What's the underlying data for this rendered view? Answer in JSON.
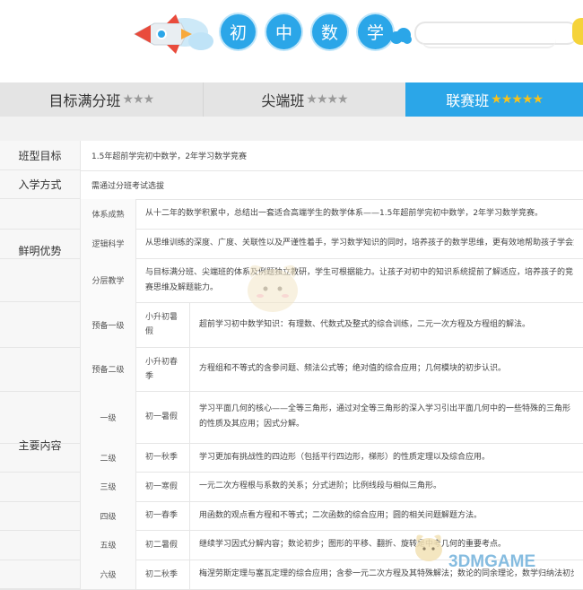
{
  "header": {
    "title_chars": [
      "初",
      "中",
      "数",
      "学"
    ]
  },
  "tabs": [
    {
      "label": "目标满分班",
      "stars": "★★★",
      "star_color": "grey"
    },
    {
      "label": "尖端班",
      "stars": "★★★★",
      "star_color": "grey"
    },
    {
      "label": "联赛班",
      "stars": "★★★★★",
      "star_color": "gold",
      "active": true
    }
  ],
  "rows": {
    "goal": {
      "label": "班型目标",
      "value": "1.5年超前学完初中数学，2年学习数学竞赛"
    },
    "admission": {
      "label": "入学方式",
      "value": "需通过分班考试选拔"
    },
    "advantages": {
      "label": "鲜明优势",
      "items": [
        {
          "name": "体系成熟",
          "desc": "从十二年的数学积累中，总结出一套适合高端学生的数学体系——1.5年超前学完初中数学，2年学习数学竞赛。"
        },
        {
          "name": "逻辑科学",
          "desc": "从思维训练的深度、广度、关联性以及严谨性着手，学习数学知识的同时，培养孩子的数学思维，更有效地帮助孩子学会如何思考问题"
        },
        {
          "name": "分层教学",
          "desc": "与目标满分班、尖端班的体系及例题独立教研，学生可根据能力。让孩子对初中的知识系统提前了解适应，培养孩子的竞赛思维及解题能力。"
        }
      ]
    },
    "content": {
      "label": "主要内容",
      "items": [
        {
          "level": "预备一级",
          "season": "小升初暑假",
          "desc": "超前学习初中数学知识：有理数、代数式及整式的综合训练，二元一次方程及方程组的解法。"
        },
        {
          "level": "预备二级",
          "season": "小升初春季",
          "desc": "方程组和不等式的含参问题、频法公式等；绝对值的综合应用；几何模块的初步认识。"
        },
        {
          "level": "一级",
          "season": "初一暑假",
          "desc": "学习平面几何的核心——全等三角形，通过对全等三角形的深入学习引出平面几何中的一些特殊的三角形的性质及其应用；因式分解。"
        },
        {
          "level": "二级",
          "season": "初一秋季",
          "desc": "学习更加有挑战性的四边形（包括平行四边形，梯形）的性质定理以及综合应用。"
        },
        {
          "level": "三级",
          "season": "初一寒假",
          "desc": "一元二次方程根与系数的关系；分式进阶；比例线段与相似三角形。"
        },
        {
          "level": "四级",
          "season": "初一春季",
          "desc": "用函数的观点看方程和不等式；二次函数的综合应用；圆的相关问题解题方法。"
        },
        {
          "level": "五级",
          "season": "初二暑假",
          "desc": "继续学习因式分解内容；数论初步；图形的平移、翻折、旋转是中考几何的重要考点。"
        },
        {
          "level": "六级",
          "season": "初二秋季",
          "desc": "梅涅劳斯定理与塞瓦定理的综合应用；含参一元二次方程及其特殊解法；数论的同余理论，数学归纳法初步。"
        }
      ]
    }
  },
  "watermark": {
    "logo": "3DMGAME"
  },
  "colors": {
    "accent": "#2ba6e8",
    "tab_bg": "#e4e4e4",
    "star_gold": "#f7c21b",
    "star_grey": "#9a9a9a"
  }
}
